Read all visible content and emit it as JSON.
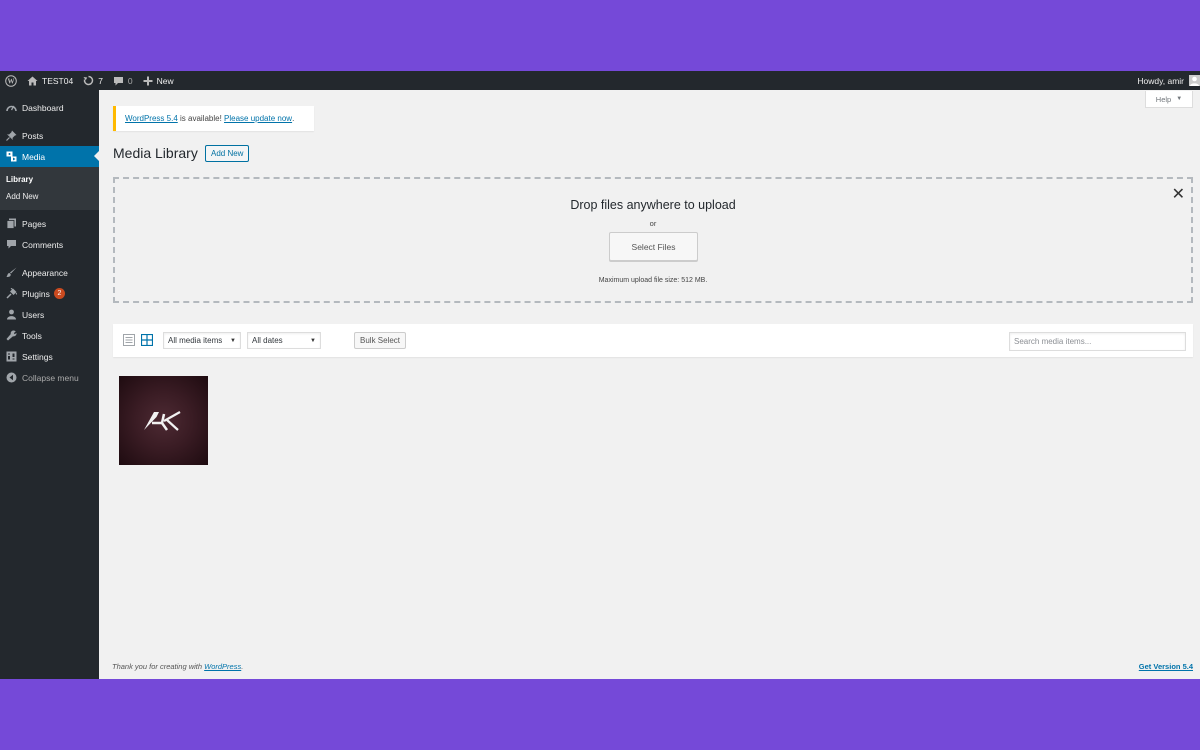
{
  "adminbar": {
    "site_name": "TEST04",
    "updates_count": "7",
    "comments_count": "0",
    "new_label": "New",
    "howdy": "Howdy, amir",
    "icons": [
      "wordpress-logo-icon",
      "home-icon",
      "updates-icon",
      "comment-icon",
      "plus-icon"
    ]
  },
  "sidebar": {
    "items": [
      {
        "label": "Dashboard",
        "icon": "dashboard-icon"
      },
      {
        "label": "Posts",
        "icon": "pin-icon"
      },
      {
        "label": "Media",
        "icon": "media-icon"
      },
      {
        "label": "Pages",
        "icon": "page-icon"
      },
      {
        "label": "Comments",
        "icon": "comment-icon"
      },
      {
        "label": "Appearance",
        "icon": "brush-icon"
      },
      {
        "label": "Plugins",
        "icon": "plug-icon",
        "badge": "2"
      },
      {
        "label": "Users",
        "icon": "user-icon"
      },
      {
        "label": "Tools",
        "icon": "wrench-icon"
      },
      {
        "label": "Settings",
        "icon": "settings-icon"
      },
      {
        "label": "Collapse menu",
        "icon": "collapse-icon"
      }
    ],
    "submenu": [
      "Library",
      "Add New"
    ],
    "active": "Media",
    "active_color": "#0073aa"
  },
  "help": {
    "label": "Help"
  },
  "notice": {
    "link1": "WordPress 5.4",
    "middle": " is available! ",
    "link2": "Please update now",
    "end": "."
  },
  "page": {
    "title": "Media Library",
    "add_new": "Add New"
  },
  "uploader": {
    "title": "Drop files anywhere to upload",
    "or": "or",
    "button": "Select Files",
    "max_size": "Maximum upload file size: 512 MB."
  },
  "toolbar": {
    "filter_type": "All media items",
    "filter_date": "All dates",
    "bulk": "Bulk Select",
    "search_placeholder": "Search media items..."
  },
  "attachments": [
    {
      "name": "AK logo image",
      "logo_text": "AK"
    }
  ],
  "footer": {
    "thanks_prefix": "Thank you for creating with ",
    "thanks_link": "WordPress",
    "thanks_suffix": ".",
    "version": "Get Version 5.4"
  },
  "colors": {
    "background": "#7549d8",
    "adminbar": "#23282d",
    "link": "#0073aa",
    "notice_border": "#ffb900",
    "badge": "#ca4a1f"
  }
}
